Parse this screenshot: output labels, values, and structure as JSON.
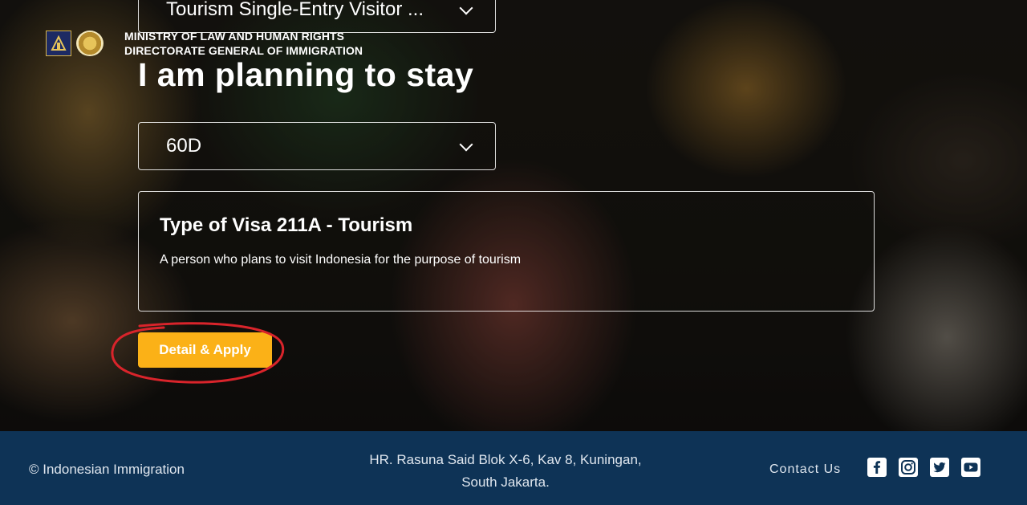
{
  "brand": {
    "line1": "MINISTRY OF  LAW  AND HUMAN RIGHTS",
    "line2": "DIRECTORATE GENERAL OF IMMIGRATION"
  },
  "visa_select": {
    "value": "Tourism Single-Entry Visitor ..."
  },
  "stay_heading": "I am planning to stay",
  "stay_select": {
    "value": "60D"
  },
  "visa_card": {
    "title": "Type of Visa 211A - Tourism",
    "description": "A person who plans to visit Indonesia for the purpose of tourism"
  },
  "apply_button": {
    "label": "Detail & Apply"
  },
  "colors": {
    "accent": "#fbb117",
    "footer_bg": "#0e3356",
    "annotation": "#d9242b"
  },
  "footer": {
    "copyright": "© Indonesian Immigration",
    "address_line1": "HR. Rasuna Said Blok X-6, Kav 8, Kuningan,",
    "address_line2": "South Jakarta.",
    "contact": "Contact Us",
    "socials": [
      "facebook-icon",
      "instagram-icon",
      "twitter-icon",
      "youtube-icon"
    ]
  }
}
